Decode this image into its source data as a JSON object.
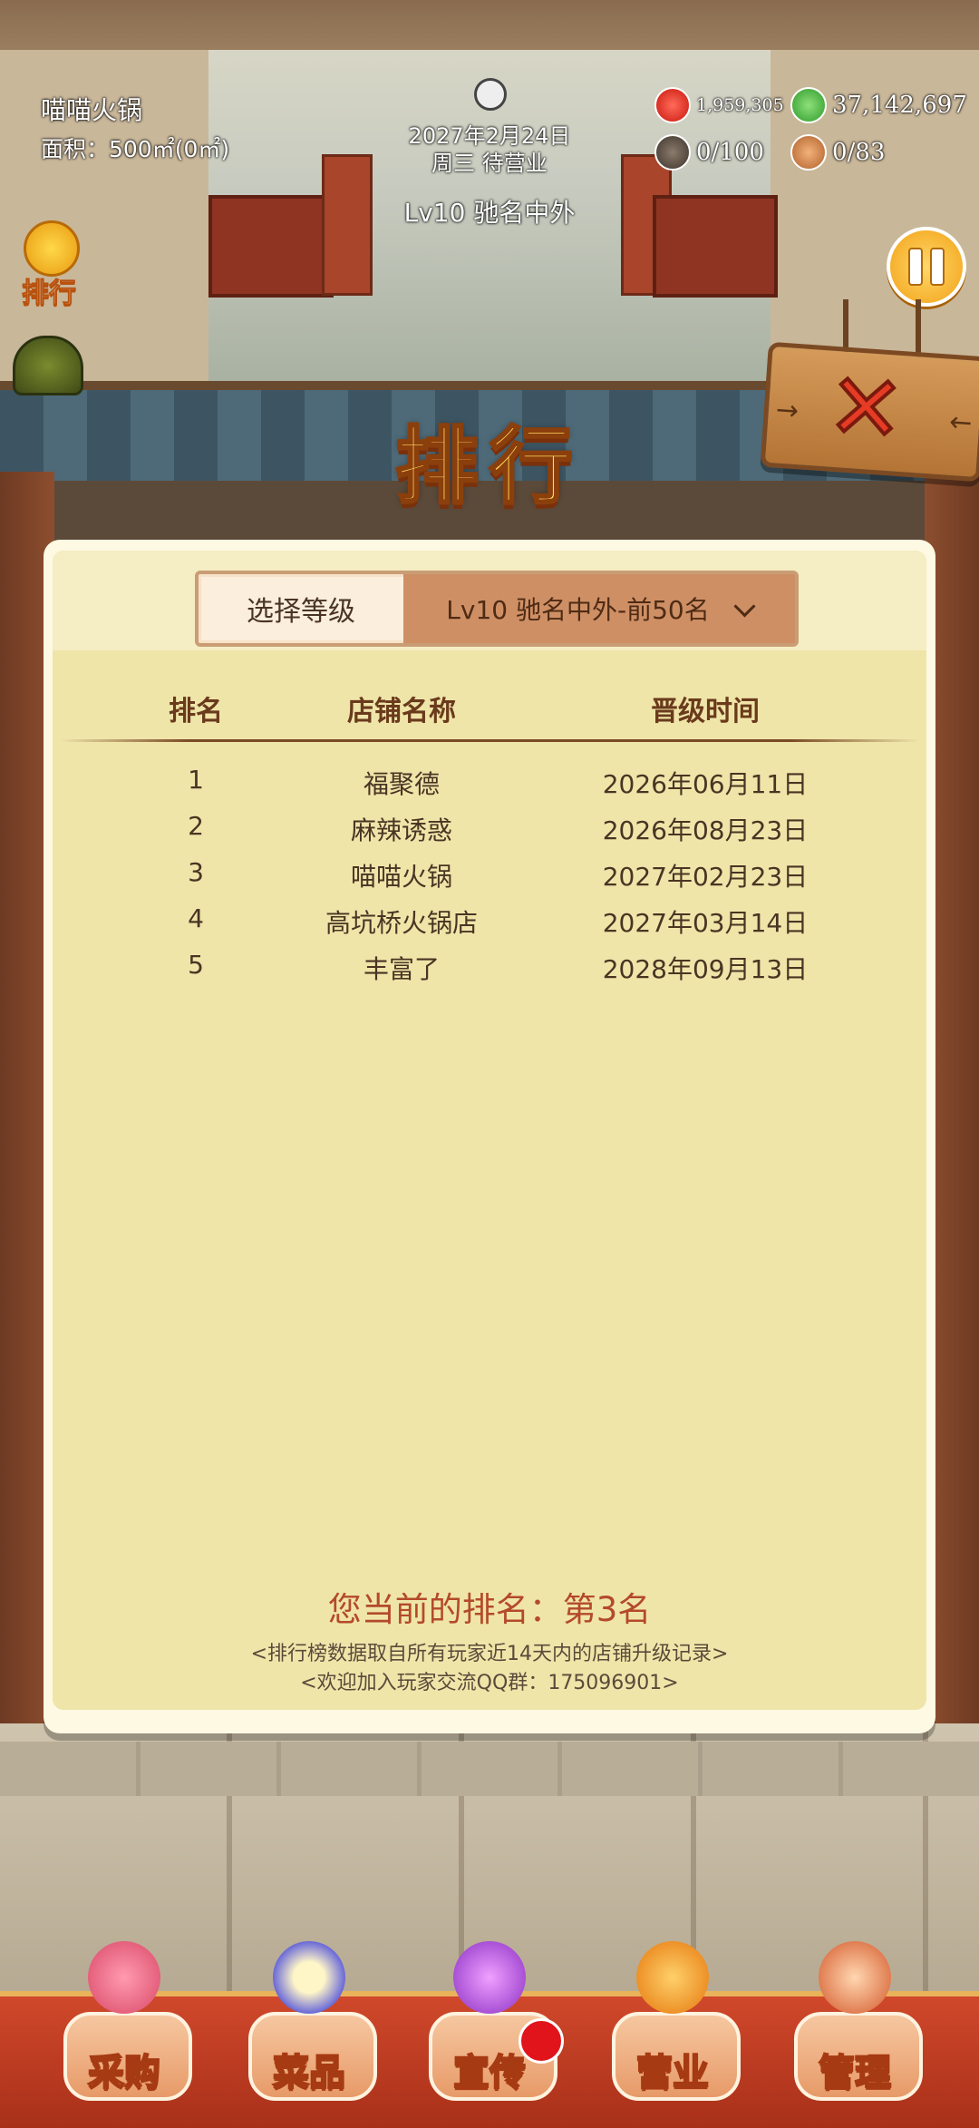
{
  "hud": {
    "shop_name": "喵喵火锅",
    "area": "面积：500㎡(0㎡)",
    "date": "2027年2月24日",
    "day_status": "周三 待营业",
    "level_title": "Lv10 驰名中外",
    "hearts": "1,959,305",
    "cash": "37,142,697",
    "tables": "0/100",
    "staff": "0/83",
    "rank_button_label": "排行"
  },
  "title": "排行",
  "panel": {
    "select_label": "选择等级",
    "select_value": "Lv10 驰名中外-前50名",
    "columns": [
      "排名",
      "店铺名称",
      "晋级时间"
    ],
    "rows": [
      {
        "rank": "1",
        "name": "福聚德",
        "time": "2026年06月11日"
      },
      {
        "rank": "2",
        "name": "麻辣诱惑",
        "time": "2026年08月23日"
      },
      {
        "rank": "3",
        "name": "喵喵火锅",
        "time": "2027年02月23日"
      },
      {
        "rank": "4",
        "name": "高坑桥火锅店",
        "time": "2027年03月14日"
      },
      {
        "rank": "5",
        "name": "丰富了",
        "time": "2028年09月13日"
      }
    ],
    "my_rank": "您当前的排名：第3名",
    "note1": "<排行榜数据取自所有玩家近14天内的店铺升级记录>",
    "note2": "<欢迎加入玩家交流QQ群：175096901>"
  },
  "nav": [
    {
      "label": "采购",
      "icon": "shop-stall-icon"
    },
    {
      "label": "菜品",
      "icon": "dish-bowl-icon"
    },
    {
      "label": "宣传",
      "icon": "video-play-icon"
    },
    {
      "label": "营业",
      "icon": "service-bell-icon"
    },
    {
      "label": "管理",
      "icon": "staff-people-icon"
    }
  ],
  "colors": {
    "panel_bg": "#efe5a9",
    "accent_red": "#b44a2a",
    "title_gold": "#ffd861",
    "nav_red": "#d0482b"
  }
}
